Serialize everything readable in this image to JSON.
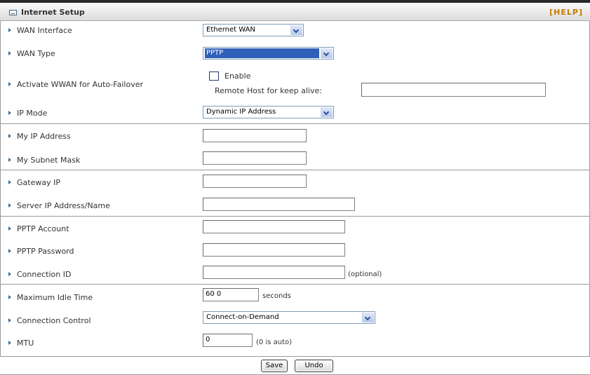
{
  "header": {
    "title": "Internet Setup",
    "help": "[HELP]"
  },
  "fields": {
    "wan_interface": {
      "label": "WAN Interface",
      "value": "Ethernet WAN"
    },
    "wan_type": {
      "label": "WAN Type",
      "value": "PPTP"
    },
    "wwan_failover": {
      "label": "Activate WWAN for Auto-Failover",
      "checkbox_label": "Enable",
      "checked": false,
      "remote_host_label": "Remote Host for keep alive:",
      "remote_host_value": ""
    },
    "ip_mode": {
      "label": "IP Mode",
      "value": "Dynamic IP Address"
    },
    "my_ip": {
      "label": "My IP Address",
      "value": ""
    },
    "subnet": {
      "label": "My Subnet Mask",
      "value": ""
    },
    "gateway": {
      "label": "Gateway IP",
      "value": ""
    },
    "server": {
      "label": "Server IP Address/Name",
      "value": ""
    },
    "pptp_account": {
      "label": "PPTP Account",
      "value": ""
    },
    "pptp_password": {
      "label": "PPTP Password",
      "value": ""
    },
    "connection_id": {
      "label": "Connection ID",
      "value": "",
      "suffix": "(optional)"
    },
    "idle_time": {
      "label": "Maximum Idle Time",
      "value": "60 0",
      "suffix": "seconds"
    },
    "connection_control": {
      "label": "Connection Control",
      "value": "Connect-on-Demand"
    },
    "mtu": {
      "label": "MTU",
      "value": "0",
      "suffix": "(0 is auto)"
    }
  },
  "buttons": {
    "save": "Save",
    "undo": "Undo"
  },
  "colors": {
    "header_border": "#2a2a2a",
    "help_text": "#c47a00",
    "arrow": "#3c6d9c",
    "selected_option": "#2f5fb9"
  }
}
